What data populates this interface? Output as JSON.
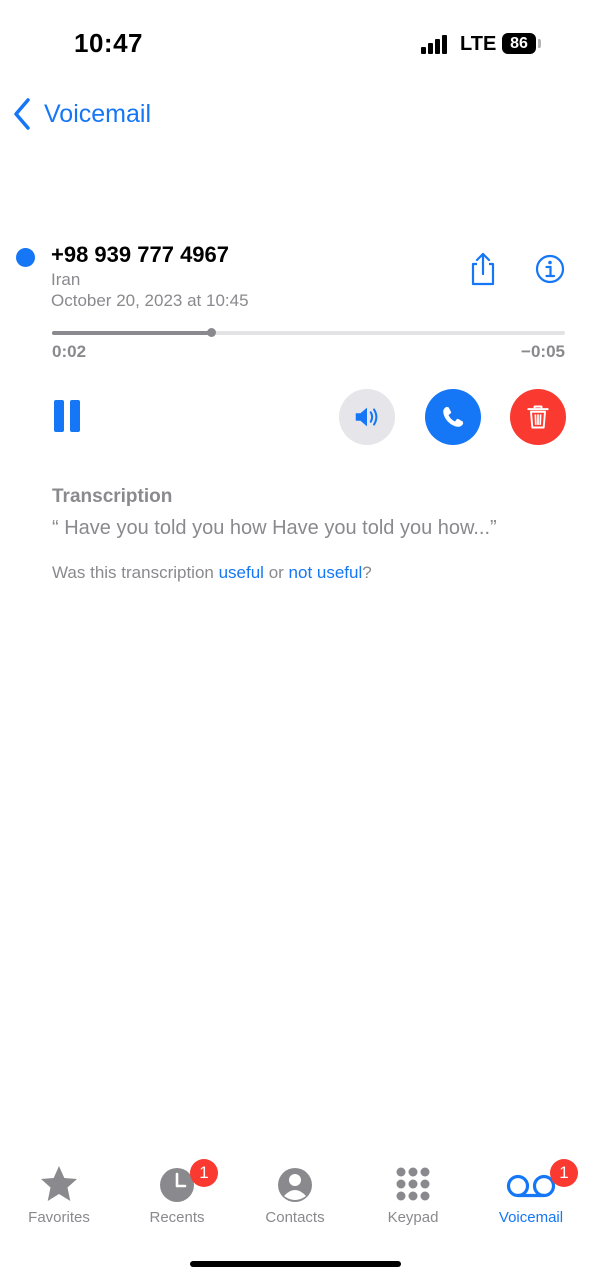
{
  "status_bar": {
    "time": "10:47",
    "network": "LTE",
    "battery": "86"
  },
  "nav": {
    "back_label": "Voicemail"
  },
  "voicemail": {
    "number": "+98 939 777 4967",
    "location": "Iran",
    "date": "October 20, 2023 at 10:45",
    "progress_fraction": 0.31,
    "elapsed": "0:02",
    "remaining": "−0:05"
  },
  "transcription": {
    "heading": "Transcription",
    "text": "“ Have you told you how Have you told you how...”",
    "feedback_prefix": "Was this transcription ",
    "useful": "useful",
    "or": " or ",
    "not_useful": "not useful",
    "suffix": "?"
  },
  "tabs": [
    {
      "label": "Favorites",
      "icon": "star-icon"
    },
    {
      "label": "Recents",
      "icon": "clock-icon",
      "badge": "1"
    },
    {
      "label": "Contacts",
      "icon": "person-icon"
    },
    {
      "label": "Keypad",
      "icon": "keypad-icon"
    },
    {
      "label": "Voicemail",
      "icon": "voicemail-icon",
      "badge": "1",
      "active": true
    }
  ],
  "colors": {
    "accent": "#1577f6",
    "danger": "#fa3a30",
    "secondary_text": "#8a8a8e"
  }
}
